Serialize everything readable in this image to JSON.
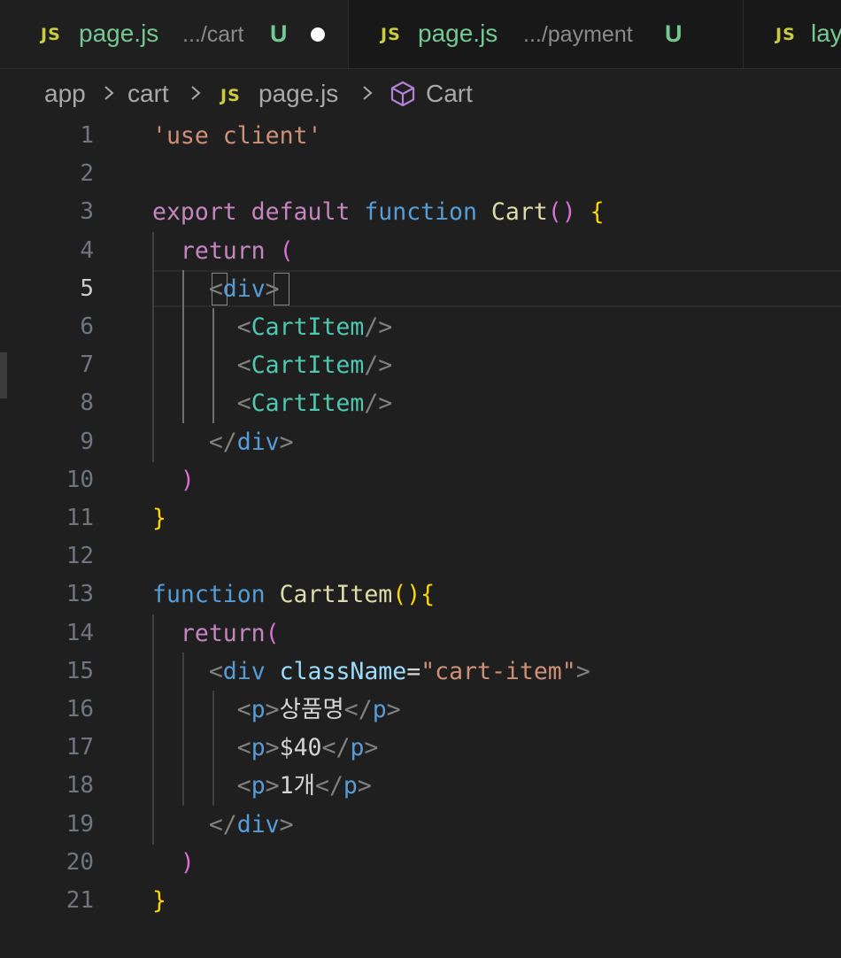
{
  "tabs": [
    {
      "name": "page.js",
      "path": ".../cart",
      "status": "U",
      "dirty": true,
      "active": true
    },
    {
      "name": "page.js",
      "path": ".../payment",
      "status": "U",
      "dirty": false,
      "active": false
    },
    {
      "name": "lay",
      "path": "",
      "status": "",
      "dirty": false,
      "active": false
    }
  ],
  "js_badge": "JS",
  "breadcrumb": {
    "items": [
      "app",
      "cart",
      "page.js",
      "Cart"
    ]
  },
  "editor": {
    "current_line": 5,
    "line_numbers": [
      "1",
      "2",
      "3",
      "4",
      "5",
      "6",
      "7",
      "8",
      "9",
      "10",
      "11",
      "12",
      "13",
      "14",
      "15",
      "16",
      "17",
      "18",
      "19",
      "20",
      "21"
    ],
    "lines": [
      [
        {
          "t": "'use client'",
          "c": "str"
        }
      ],
      [],
      [
        {
          "t": "export default ",
          "c": "kw"
        },
        {
          "t": "function ",
          "c": "fn-kw"
        },
        {
          "t": "Cart",
          "c": "fn"
        },
        {
          "t": "()",
          "c": "br2"
        },
        {
          "t": " ",
          "c": "text"
        },
        {
          "t": "{",
          "c": "br1"
        }
      ],
      [
        {
          "t": "  return ",
          "c": "kw"
        },
        {
          "t": "(",
          "c": "br2"
        }
      ],
      [
        {
          "t": "    ",
          "c": "text"
        },
        {
          "t": "<",
          "c": "punct"
        },
        {
          "t": "div",
          "c": "tag"
        },
        {
          "t": ">",
          "c": "punct"
        }
      ],
      [
        {
          "t": "      ",
          "c": "text"
        },
        {
          "t": "<",
          "c": "punct"
        },
        {
          "t": "CartItem",
          "c": "comp"
        },
        {
          "t": "/>",
          "c": "punct"
        }
      ],
      [
        {
          "t": "      ",
          "c": "text"
        },
        {
          "t": "<",
          "c": "punct"
        },
        {
          "t": "CartItem",
          "c": "comp"
        },
        {
          "t": "/>",
          "c": "punct"
        }
      ],
      [
        {
          "t": "      ",
          "c": "text"
        },
        {
          "t": "<",
          "c": "punct"
        },
        {
          "t": "CartItem",
          "c": "comp"
        },
        {
          "t": "/>",
          "c": "punct"
        }
      ],
      [
        {
          "t": "    ",
          "c": "text"
        },
        {
          "t": "</",
          "c": "punct"
        },
        {
          "t": "div",
          "c": "tag"
        },
        {
          "t": ">",
          "c": "punct"
        }
      ],
      [
        {
          "t": "  ",
          "c": "text"
        },
        {
          "t": ")",
          "c": "br2"
        }
      ],
      [
        {
          "t": "}",
          "c": "br1"
        }
      ],
      [],
      [
        {
          "t": "function ",
          "c": "fn-kw"
        },
        {
          "t": "CartItem",
          "c": "fn"
        },
        {
          "t": "()",
          "c": "br1"
        },
        {
          "t": "{",
          "c": "br1"
        }
      ],
      [
        {
          "t": "  return",
          "c": "kw"
        },
        {
          "t": "(",
          "c": "br2"
        }
      ],
      [
        {
          "t": "    ",
          "c": "text"
        },
        {
          "t": "<",
          "c": "punct"
        },
        {
          "t": "div ",
          "c": "tag"
        },
        {
          "t": "className",
          "c": "attr"
        },
        {
          "t": "=",
          "c": "text"
        },
        {
          "t": "\"cart-item\"",
          "c": "str"
        },
        {
          "t": ">",
          "c": "punct"
        }
      ],
      [
        {
          "t": "      ",
          "c": "text"
        },
        {
          "t": "<",
          "c": "punct"
        },
        {
          "t": "p",
          "c": "tag"
        },
        {
          "t": ">",
          "c": "punct"
        },
        {
          "t": "상품명",
          "c": "text"
        },
        {
          "t": "</",
          "c": "punct"
        },
        {
          "t": "p",
          "c": "tag"
        },
        {
          "t": ">",
          "c": "punct"
        }
      ],
      [
        {
          "t": "      ",
          "c": "text"
        },
        {
          "t": "<",
          "c": "punct"
        },
        {
          "t": "p",
          "c": "tag"
        },
        {
          "t": ">",
          "c": "punct"
        },
        {
          "t": "$40",
          "c": "text"
        },
        {
          "t": "</",
          "c": "punct"
        },
        {
          "t": "p",
          "c": "tag"
        },
        {
          "t": ">",
          "c": "punct"
        }
      ],
      [
        {
          "t": "      ",
          "c": "text"
        },
        {
          "t": "<",
          "c": "punct"
        },
        {
          "t": "p",
          "c": "tag"
        },
        {
          "t": ">",
          "c": "punct"
        },
        {
          "t": "1개",
          "c": "text"
        },
        {
          "t": "</",
          "c": "punct"
        },
        {
          "t": "p",
          "c": "tag"
        },
        {
          "t": ">",
          "c": "punct"
        }
      ],
      [
        {
          "t": "    ",
          "c": "text"
        },
        {
          "t": "</",
          "c": "punct"
        },
        {
          "t": "div",
          "c": "tag"
        },
        {
          "t": ">",
          "c": "punct"
        }
      ],
      [
        {
          "t": "  ",
          "c": "text"
        },
        {
          "t": ")",
          "c": "br2"
        }
      ],
      [
        {
          "t": "}",
          "c": "br1"
        }
      ]
    ]
  },
  "colors": {
    "editor_bg": "#1f1f1f",
    "tabbar_bg": "#181818",
    "untracked_green": "#73c991",
    "js_yellow": "#cbcb41",
    "string": "#ce9178",
    "keyword": "#c586c0",
    "function_keyword": "#569cd6",
    "function_name": "#dcdcaa",
    "component": "#4ec9b0",
    "bracket_gold": "#ffd700",
    "bracket_orchid": "#da70d6"
  },
  "icons": {
    "breadcrumb_separator": "chevron-right-icon",
    "symbol": "cube-icon",
    "file_type": "js-icon",
    "dirty_indicator": "dot-icon"
  }
}
